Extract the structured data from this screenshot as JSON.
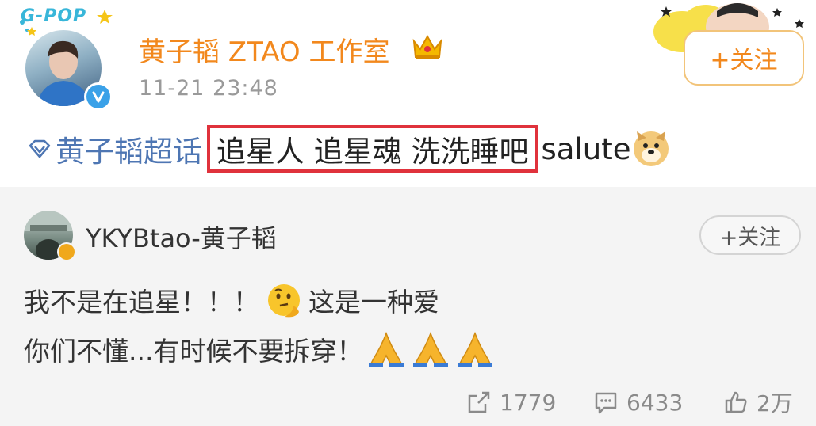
{
  "header": {
    "avatar_badge": "G-POP",
    "author_name": "黄子韬 ZTAO 工作室",
    "timestamp": "11-21 23:48",
    "follow_label": "+关注",
    "crown_icon": "crown-icon",
    "verified_icon": "verified-v-icon"
  },
  "post": {
    "topic_link": "黄子韬超话",
    "highlighted_text": "追星人 追星魂 洗洗睡吧",
    "trailing_text": "salute",
    "emoji": "doge-emoji",
    "highlight_color": "#e0323c",
    "link_color": "#4e76b3",
    "author_color": "#f2881d"
  },
  "repost": {
    "author_name": "YKYBtao-黄子韬",
    "follow_label": "+关注",
    "line1_part1": "我不是在追星！！！",
    "line1_emoji": "thinking-emoji",
    "line1_part2": "这是一种爱",
    "line2_text": "你们不懂...有时候不要拆穿！",
    "line2_emoji": "folded-hands-emoji",
    "stats": {
      "reposts": "1779",
      "comments": "6433",
      "likes": "2万"
    }
  }
}
